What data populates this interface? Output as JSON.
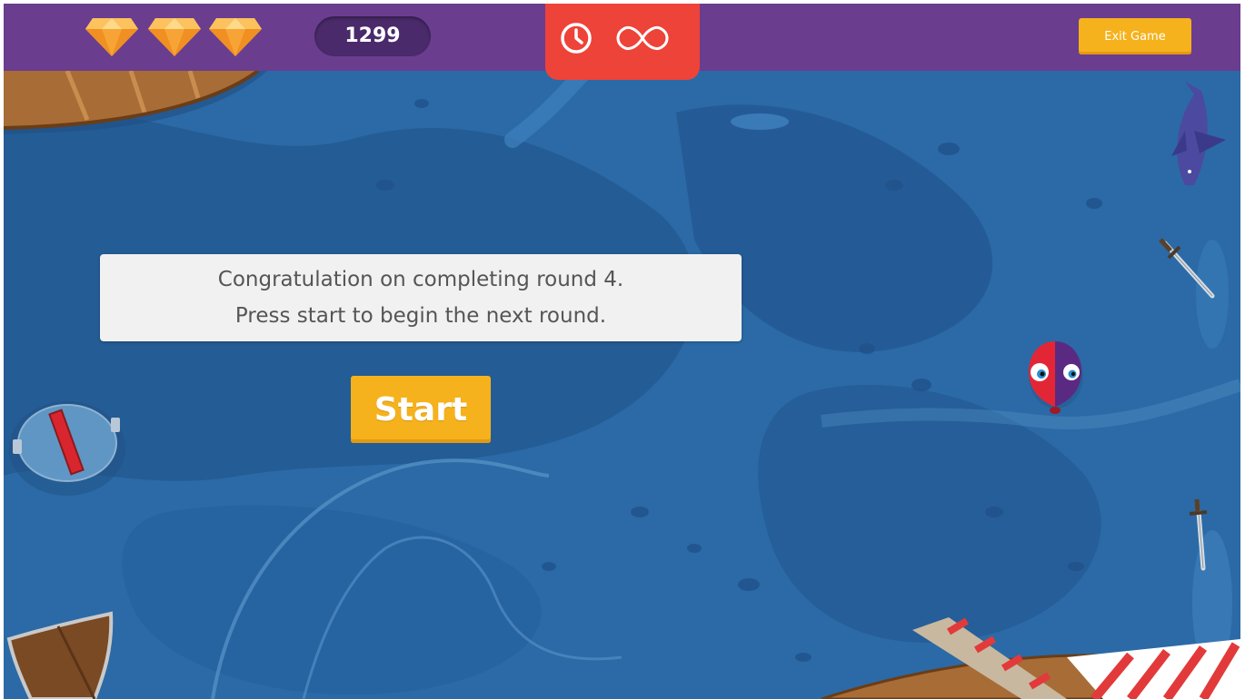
{
  "hud": {
    "lives_icon": "gem-icon",
    "lives_count": 3,
    "score": "1299",
    "timer_icon": "clock-icon",
    "time_limit_icon": "infinity-icon",
    "exit_label": "Exit Game"
  },
  "message": {
    "line1": "Congratulation on completing round 4.",
    "line2": "Press start to begin the next round."
  },
  "start_label": "Start",
  "colors": {
    "topbar": "#6a3d8f",
    "score_pill": "#4a2a6a",
    "timer_tab": "#ee4339",
    "button": "#f6b21c",
    "water": "#2b6aa6",
    "gem": "#f7a436"
  },
  "scene_objects": [
    "boat-icon",
    "fish-icon",
    "sword-icon",
    "sword-icon",
    "shield-icon",
    "pressure-plate-icon",
    "player-character-icon",
    "plank-icon"
  ]
}
